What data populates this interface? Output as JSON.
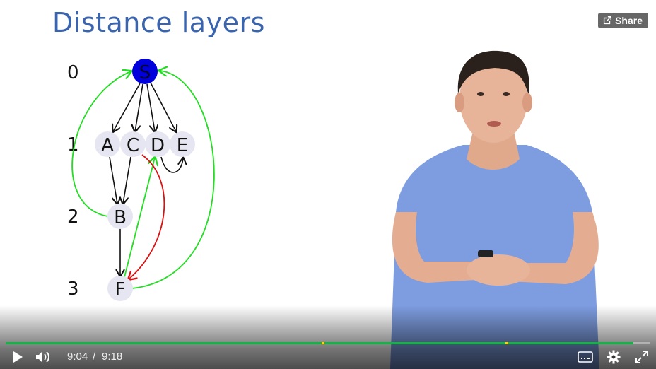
{
  "slide": {
    "title": "Distance layers",
    "layer_numbers": [
      "0",
      "1",
      "2",
      "3"
    ],
    "nodes": {
      "S": "S",
      "A": "A",
      "C": "C",
      "D": "D",
      "E": "E",
      "B": "B",
      "F": "F"
    }
  },
  "share": {
    "label": "Share",
    "icon": "external-share-icon"
  },
  "player": {
    "current_time": "9:04",
    "separator": "/",
    "duration": "9:18",
    "progress_fraction": 0.974,
    "chapter_marker_fractions": [
      0.49,
      0.775
    ],
    "colors": {
      "progress": "#19b04a",
      "marker": "#ffd400",
      "title": "#3a64ad",
      "node_s": "#0000dd",
      "node": "#e6e6f2",
      "green_edge": "#22dd22",
      "red_edge": "#dd1111"
    },
    "icons": [
      "play-icon",
      "volume-icon",
      "captions-icon",
      "settings-gear-icon",
      "fullscreen-icon"
    ]
  }
}
